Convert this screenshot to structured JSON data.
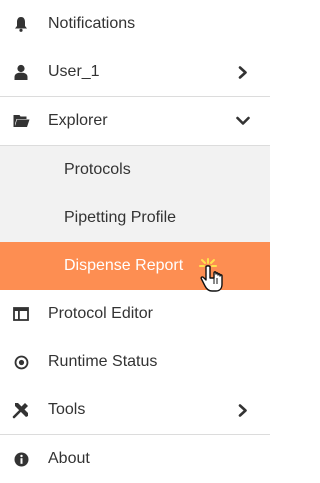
{
  "menu": {
    "notifications": {
      "label": "Notifications",
      "icon": "bell-icon"
    },
    "user": {
      "label": "User_1",
      "icon": "user-icon",
      "chevron": "chevron-right-icon"
    },
    "explorer": {
      "label": "Explorer",
      "icon": "folder-open-icon",
      "chevron": "chevron-down-icon",
      "children": [
        {
          "label": "Protocols"
        },
        {
          "label": "Pipetting Profile"
        },
        {
          "label": "Dispense Report",
          "active": true
        }
      ]
    },
    "protocol_editor": {
      "label": "Protocol Editor",
      "icon": "editor-panel-icon"
    },
    "runtime_status": {
      "label": "Runtime Status",
      "icon": "runtime-status-icon"
    },
    "tools": {
      "label": "Tools",
      "icon": "tools-icon",
      "chevron": "chevron-right-icon"
    },
    "about": {
      "label": "About",
      "icon": "info-icon"
    }
  },
  "colors": {
    "active_bg": "#fd8e52",
    "submenu_bg": "#f2f2f2",
    "text": "#333333",
    "divider": "#dcdcdc"
  }
}
